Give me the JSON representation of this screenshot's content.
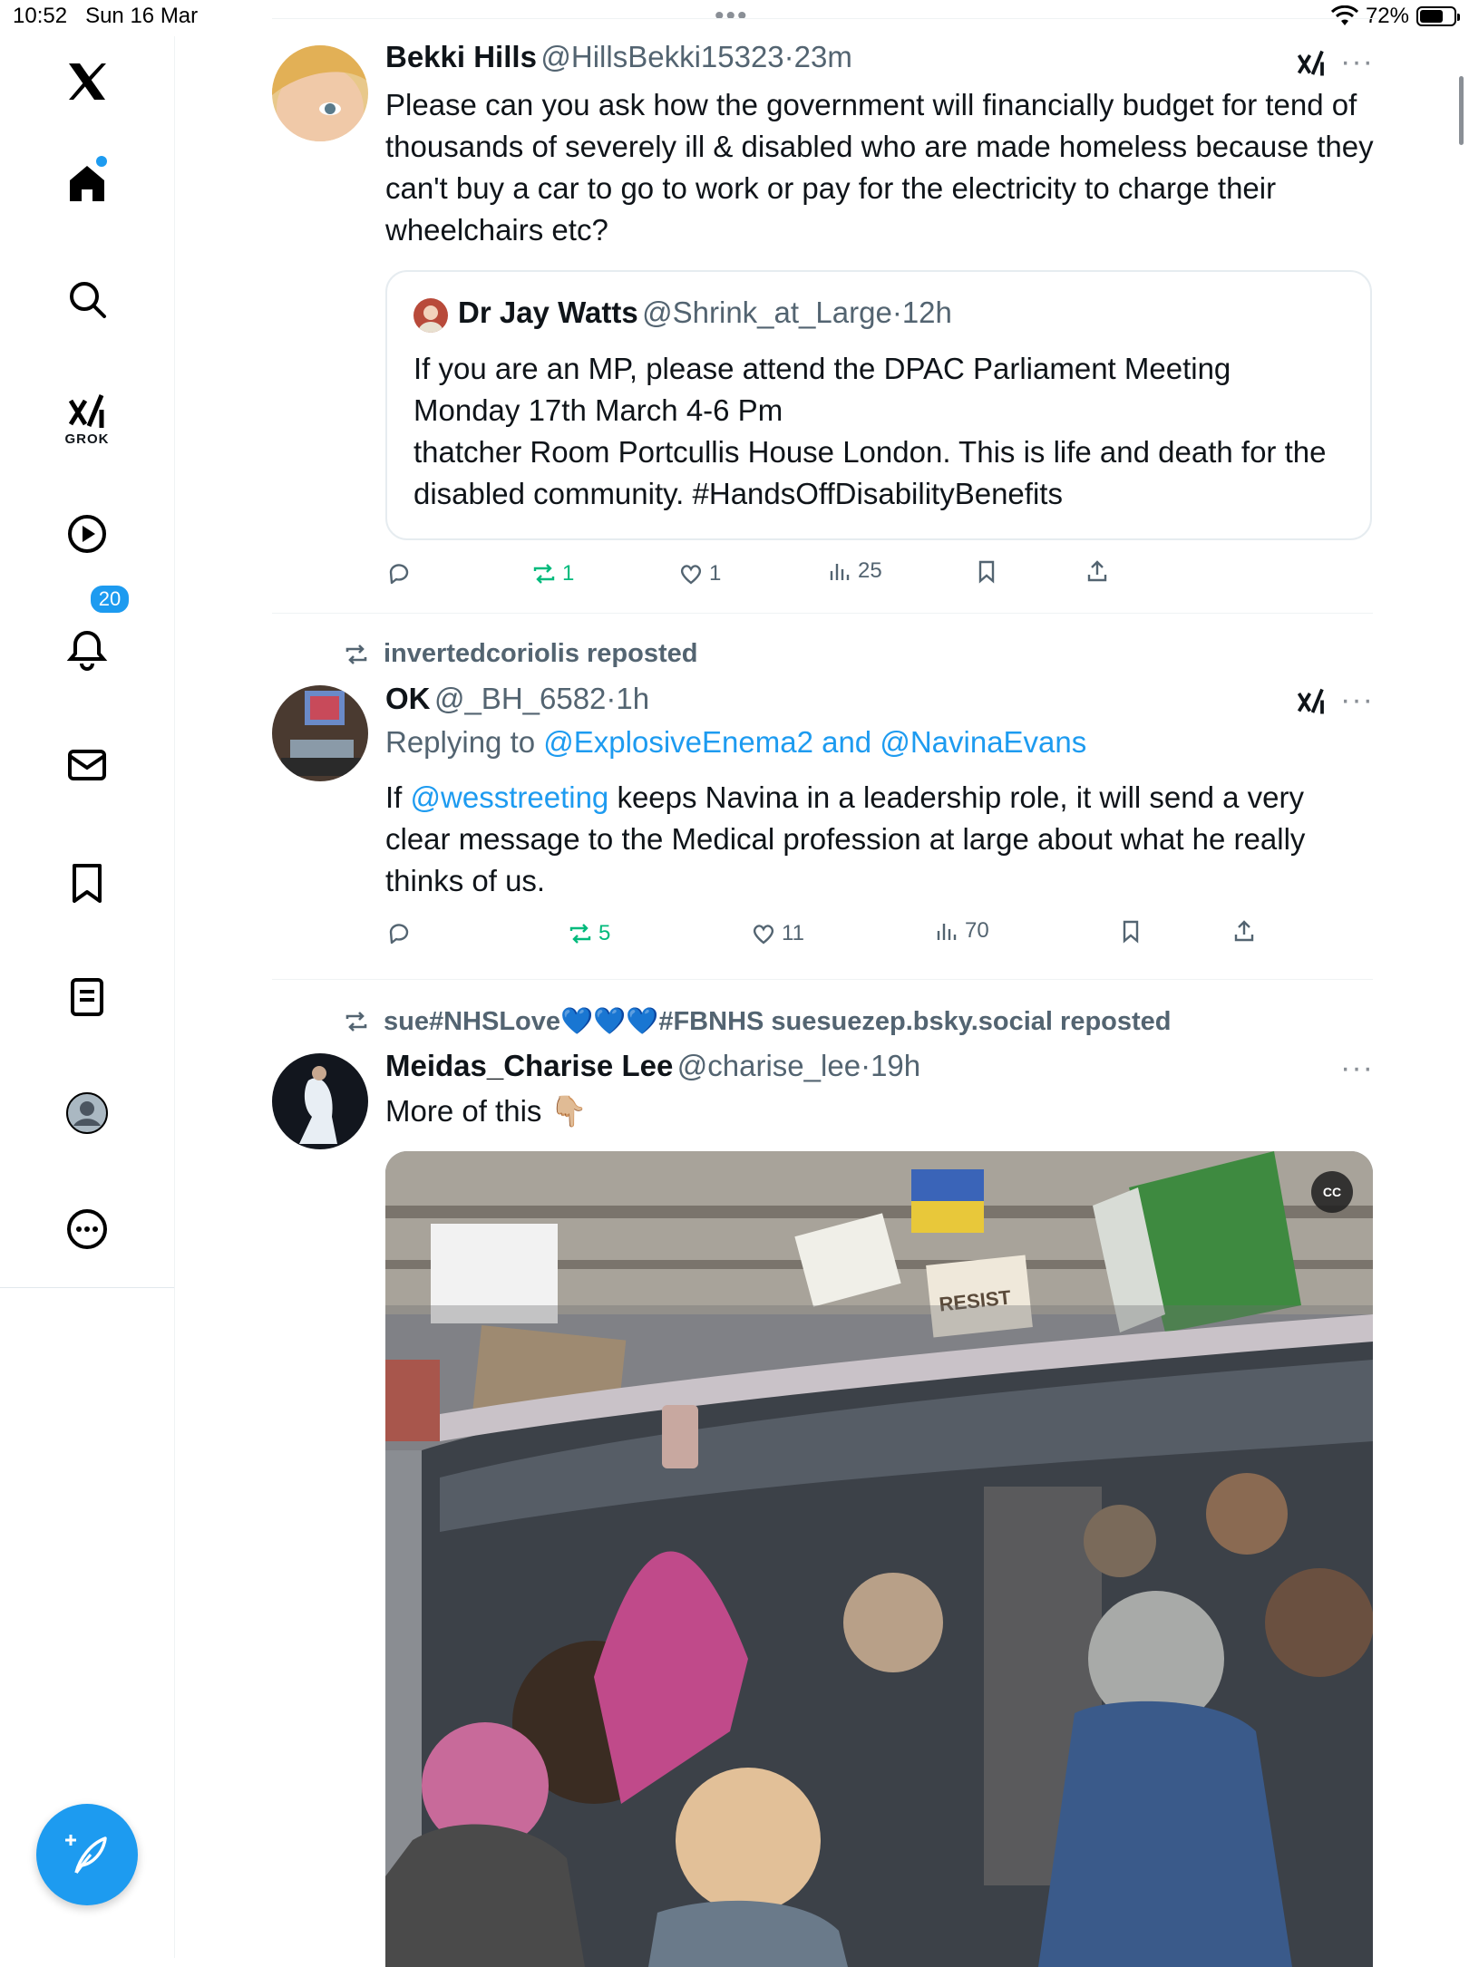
{
  "status_bar": {
    "time": "10:52",
    "date": "Sun 16 Mar",
    "battery_percent": "72%",
    "battery_level": 0.72
  },
  "sidebar": {
    "items": [
      {
        "name": "x-logo-icon"
      },
      {
        "name": "home-icon",
        "active": true,
        "has_dot": true
      },
      {
        "name": "search-icon"
      },
      {
        "name": "grok-icon",
        "label": "GROK"
      },
      {
        "name": "video-icon"
      },
      {
        "name": "notifications-icon",
        "badge": "20"
      },
      {
        "name": "messages-icon"
      },
      {
        "name": "bookmarks-icon"
      },
      {
        "name": "lists-icon"
      },
      {
        "name": "profile-icon"
      },
      {
        "name": "more-icon"
      }
    ],
    "compose_icon": "compose-icon",
    "accent_color": "#1d9bf0"
  },
  "tweets": [
    {
      "name": "Bekki Hills",
      "handle": "@HillsBekki15323",
      "sep": "·",
      "time": "23m",
      "text": "Please can you ask how the government will financially budget for tend of thousands of severely ill & disabled who are made homeless because they can't buy a car to go to work or pay for the electricity to charge their wheelchairs etc?",
      "quote": {
        "name": "Dr Jay Watts",
        "handle": "@Shrink_at_Large",
        "sep": "·",
        "time": "12h",
        "line1": "If you are an MP, please attend the DPAC Parliament Meeting",
        "line2": "Monday 17th March 4-6 Pm",
        "line3": "thatcher Room Portcullis House London. This is life and death for the disabled community. #HandsOffDisabilityBenefits"
      },
      "actions": {
        "replies": "",
        "reposts": "1",
        "likes": "1",
        "views": "25"
      }
    },
    {
      "reposted_by": "invertedcoriolis reposted",
      "name": "OK",
      "handle": "@_BH_6582",
      "sep": "·",
      "time": "1h",
      "replying_prefix": "Replying to",
      "replying_to": "@ExplosiveEnema2 and @NavinaEvans",
      "text_prefix": "If",
      "mention": "@wesstreeting",
      "text": "keeps Navina in a leadership role, it will send a very clear message to the Medical profession at large about what he really thinks of us.",
      "actions": {
        "replies": "",
        "reposts": "5",
        "likes": "11",
        "views": "70"
      }
    },
    {
      "reposted_by": "sue#NHSLove💙💙💙#FBNHS suesuezep.bsky.social reposted",
      "name": "Meidas_Charise Lee",
      "handle": "@charise_lee",
      "sep": "·",
      "time": "19h",
      "text": "More of this 👇🏼",
      "media": {
        "type": "video",
        "cc_label": "CC",
        "sign_resist": "RESIST"
      }
    }
  ]
}
